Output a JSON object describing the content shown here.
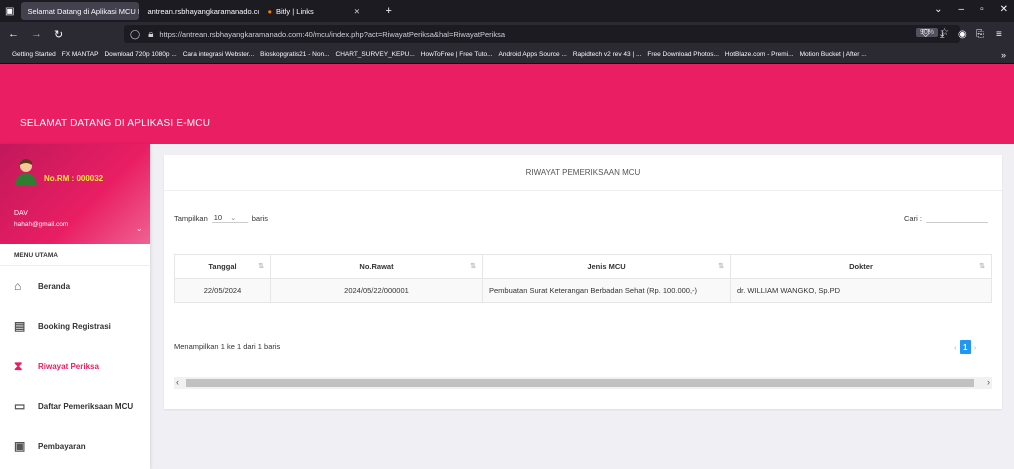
{
  "browser": {
    "tabs": [
      {
        "label": "Selamat Datang di Aplikasi MCU RS",
        "active": true
      },
      {
        "label": "antrean.rsbhayangkaramanado.com",
        "active": false
      },
      {
        "label": "Bitly | Links",
        "active": false
      }
    ],
    "url": "https://antrean.rsbhayangkaramanado.com:40/mcu/index.php?act=RiwayatPeriksa&hal=RiwayatPeriksa",
    "zoom": "90%",
    "bookmarks": [
      "Getting Started",
      "FX MANTAP",
      "Download 720p 1080p ...",
      "Cara integrasi Webster...",
      "Bioskopgratis21 - Non...",
      "CHART_SURVEY_KEPU...",
      "HowToFree | Free Tuto...",
      "Android Apps Source ...",
      "Rapidtech v2 rev 43 | ...",
      "Free Download Photos...",
      "HotBlaze.com - Premi...",
      "Motion Bucket | After ..."
    ]
  },
  "app": {
    "title": "SELAMAT DATANG DI APLIKASI E-MCU"
  },
  "user": {
    "norm": "No.RM : 000032",
    "name": "DAV",
    "email": "hahah@gmail.com"
  },
  "menu": {
    "header": "MENU UTAMA",
    "items": [
      {
        "label": "Beranda",
        "icon": "home-icon"
      },
      {
        "label": "Booking Registrasi",
        "icon": "book-icon"
      },
      {
        "label": "Riwayat Periksa",
        "icon": "hourglass-icon"
      },
      {
        "label": "Daftar Pemeriksaan MCU",
        "icon": "monitor-icon"
      },
      {
        "label": "Pembayaran",
        "icon": "card-icon"
      }
    ]
  },
  "main": {
    "card_title": "RIWAYAT PEMERIKSAAN MCU",
    "length_prefix": "Tampilkan",
    "length_value": "10",
    "length_suffix": "baris",
    "search_label": "Cari :",
    "search_value": "",
    "columns": [
      "Tanggal",
      "No.Rawat",
      "Jenis MCU",
      "Dokter"
    ],
    "rows": [
      [
        "22/05/2024",
        "2024/05/22/000001",
        "Pembuatan Surat Keterangan Berbadan Sehat (Rp. 100.000,-)",
        "dr. WILLIAM WANGKO, Sp.PD"
      ]
    ],
    "info": "Menampilkan 1 ke 1 dari 1 baris",
    "page": "1"
  },
  "colors": {
    "accent": "#e91e63",
    "pager": "#2196f3"
  }
}
